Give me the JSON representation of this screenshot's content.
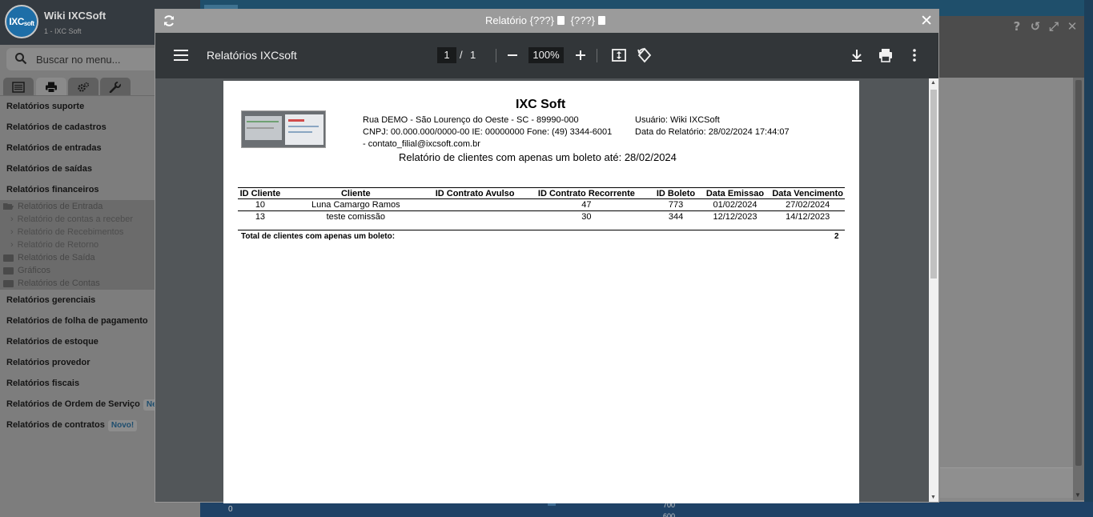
{
  "app": {
    "logo_text": "IXC",
    "logo_sub": "soft",
    "title": "Wiki IXCSoft",
    "subtitle": "1 - IXC Soft",
    "search_placeholder": "Buscar no menu..."
  },
  "sidebar": {
    "items_top": [
      "Relatórios suporte",
      "Relatórios de cadastros",
      "Relatórios de entradas",
      "Relatórios de saídas",
      "Relatórios financeiros"
    ],
    "submenu": {
      "open_folder": "Relatórios de Entrada",
      "leaves": [
        "Relatório de contas a receber",
        "Relatório de Recebimentos",
        "Relatório de Retorno"
      ],
      "folders": [
        "Relatórios de Saída",
        "Gráficos",
        "Relatórios de Contas"
      ]
    },
    "items_bottom": [
      {
        "label": "Relatórios gerenciais",
        "badge": ""
      },
      {
        "label": "Relatórios de folha de pagamento",
        "badge": ""
      },
      {
        "label": "Relatórios de estoque",
        "badge": ""
      },
      {
        "label": "Relatórios provedor",
        "badge": ""
      },
      {
        "label": "Relatórios fiscais",
        "badge": ""
      },
      {
        "label": "Relatórios de Ordem de Serviço",
        "badge": "Ne"
      },
      {
        "label": "Relatórios de contratos",
        "badge": "Novo!"
      }
    ]
  },
  "background": {
    "axis_zero": "0",
    "axis_v1": "700",
    "axis_v2": "600"
  },
  "modal": {
    "title_part1": "Relatório {???}",
    "title_part2": "{???}"
  },
  "pdf": {
    "doc_title": "Relatórios IXCsoft",
    "current_page": "1",
    "page_sep": "/",
    "total_pages": "1",
    "zoom": "100%"
  },
  "report": {
    "company": "IXC Soft",
    "address": "Rua DEMO - São Lourenço do Oeste - SC - 89990-000",
    "cnpj_line": "CNPJ: 00.000.000/0000-00  IE: 00000000  Fone: (49) 3344-6001",
    "email_line": " - contato_filial@ixcsoft.com.br",
    "user_line": "Usuário: Wiki IXCSoft",
    "date_line": "Data do Relatório: 28/02/2024 17:44:07",
    "title": "Relatório de clientes com apenas um boleto até: 28/02/2024",
    "columns": [
      "ID Cliente",
      "Cliente",
      "ID Contrato Avulso",
      "ID Contrato Recorrente",
      "ID Boleto",
      "Data Emissao",
      "Data Vencimento"
    ],
    "rows": [
      [
        "10",
        "Luna Camargo Ramos",
        "",
        "47",
        "773",
        "01/02/2024",
        "27/02/2024"
      ],
      [
        "13",
        "teste comissão",
        "",
        "30",
        "344",
        "12/12/2023",
        "14/12/2023"
      ]
    ],
    "total_label": "Total de clientes com apenas um boleto:",
    "total_value": "2"
  },
  "icons": {
    "refresh": "refresh-icon",
    "close": "close-icon",
    "download": "download-icon",
    "print": "print-icon",
    "more": "more-vert-icon",
    "fit": "fit-page-icon",
    "rotate": "rotate-icon"
  }
}
